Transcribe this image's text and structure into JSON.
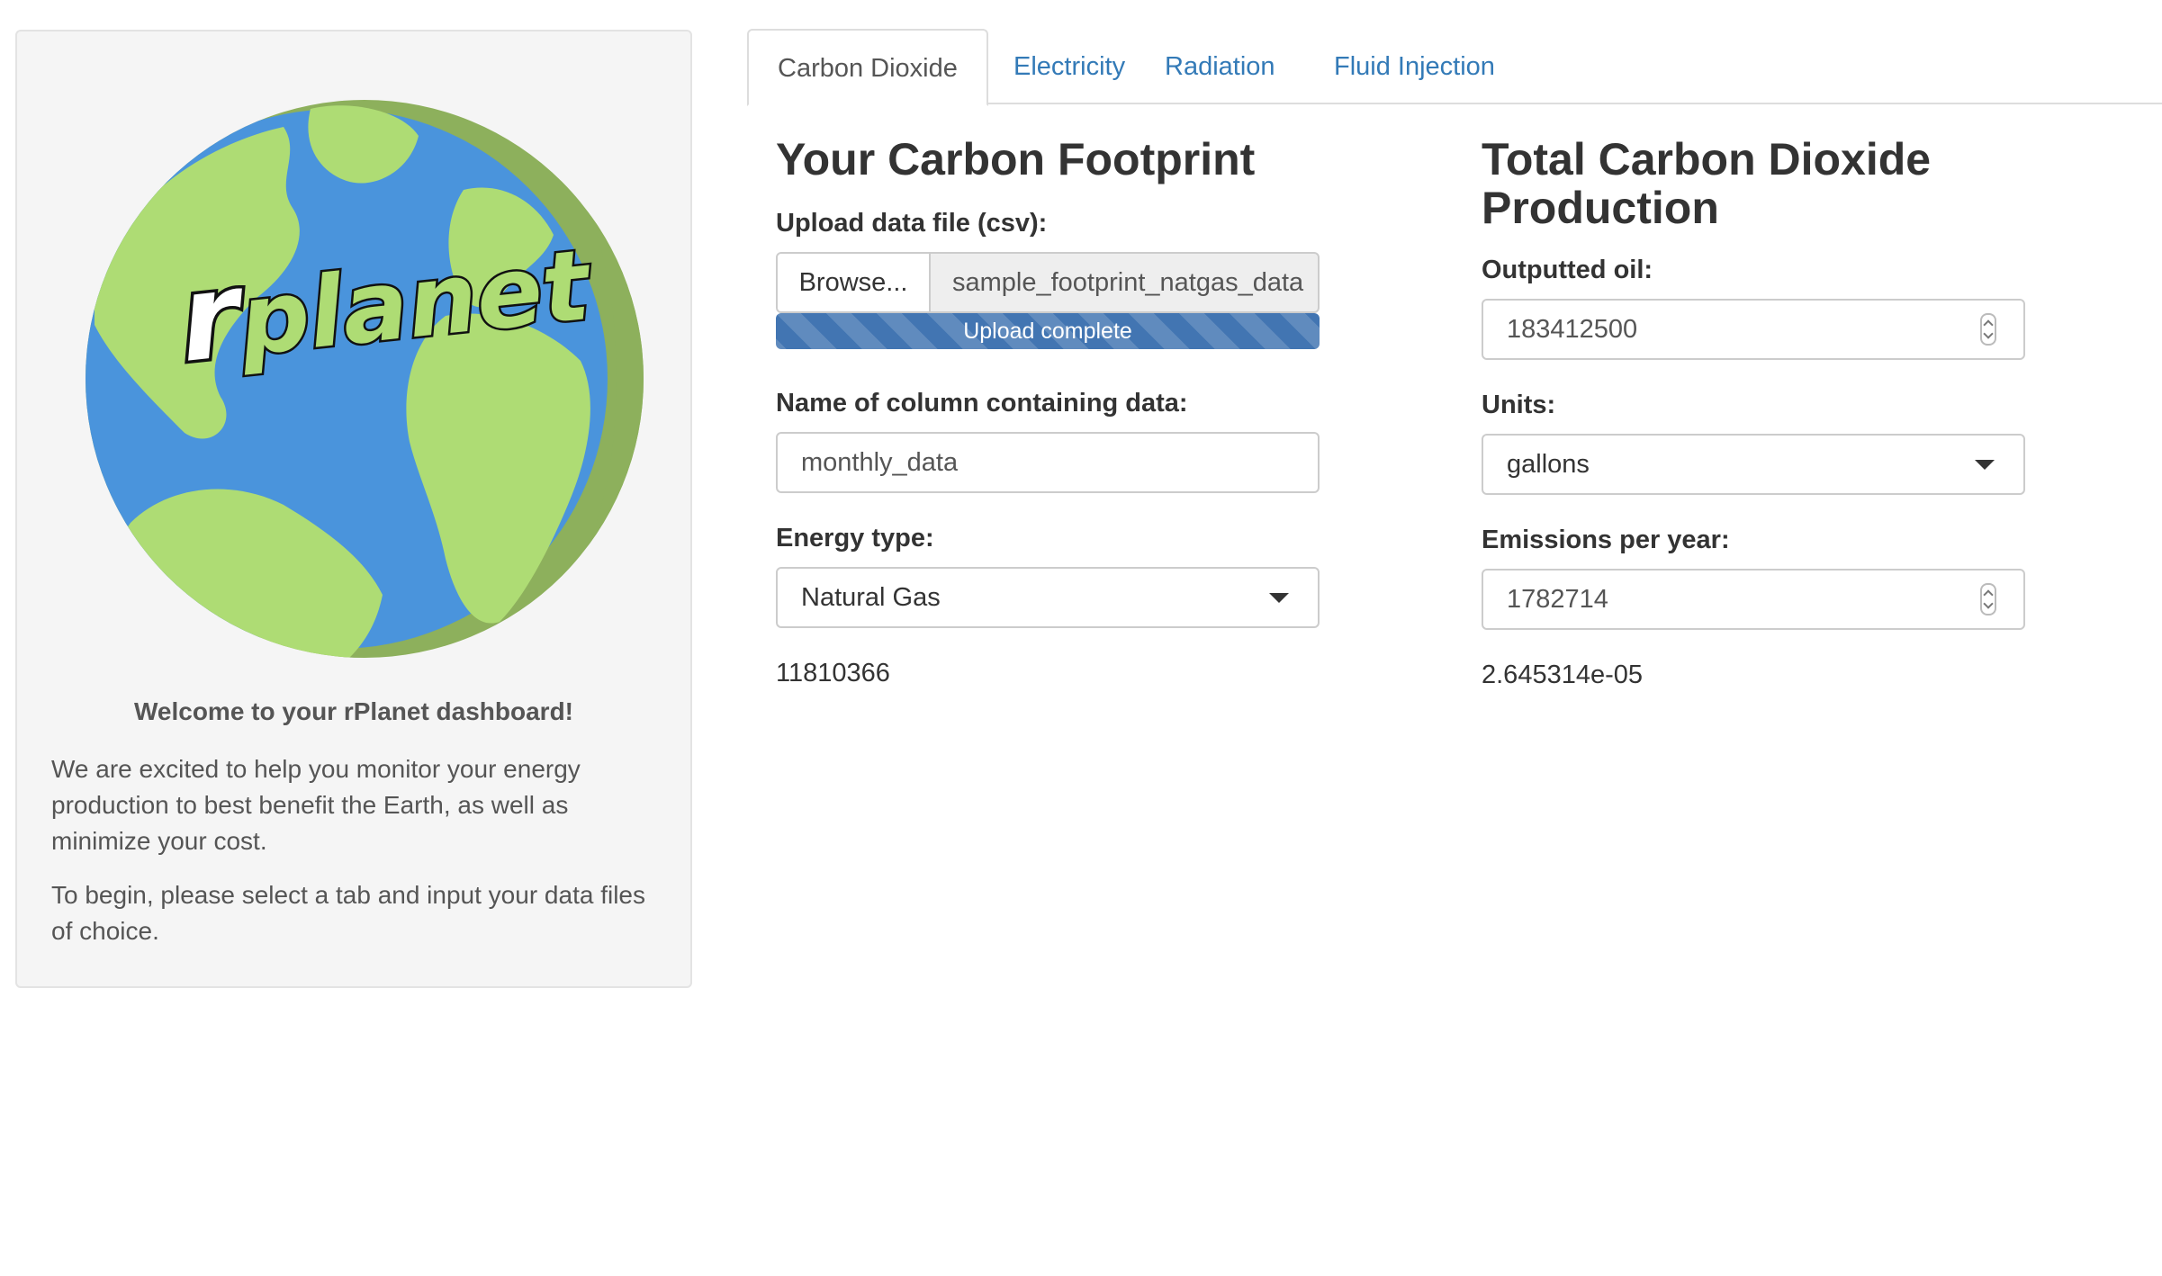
{
  "sidebar": {
    "welcome_title": "Welcome to your rPlanet dashboard!",
    "intro_1": "We are excited to help you monitor your energy production to best benefit the Earth, as well as minimize your cost.",
    "intro_2": "To begin, please select a tab and input your data files of choice.",
    "logo_text": "rplanet"
  },
  "tabs": [
    {
      "label": "Carbon Dioxide",
      "active": true
    },
    {
      "label": "Electricity",
      "active": false
    },
    {
      "label": "Radiation",
      "active": false
    },
    {
      "label": "Fluid Injection",
      "active": false
    }
  ],
  "footprint": {
    "title": "Your Carbon Footprint",
    "upload_label": "Upload data file (csv):",
    "browse_label": "Browse...",
    "file_name": "sample_footprint_natgas_data",
    "upload_status": "Upload complete",
    "upload_progress_percent": 100,
    "column_label": "Name of column containing data:",
    "column_value": "monthly_data",
    "energy_label": "Energy type:",
    "energy_selected": "Natural Gas",
    "result": "11810366"
  },
  "production": {
    "title": "Total Carbon Dioxide Production",
    "oil_label": "Outputted oil:",
    "oil_value": "183412500",
    "units_label": "Units:",
    "units_selected": "gallons",
    "emissions_label": "Emissions per year:",
    "emissions_value": "1782714",
    "result": "2.645314e-05"
  },
  "colors": {
    "link": "#337ab7",
    "progress": "#4275b2",
    "ocean": "#4a94dc",
    "land": "#aedc74",
    "shadow": "#8db05c"
  }
}
